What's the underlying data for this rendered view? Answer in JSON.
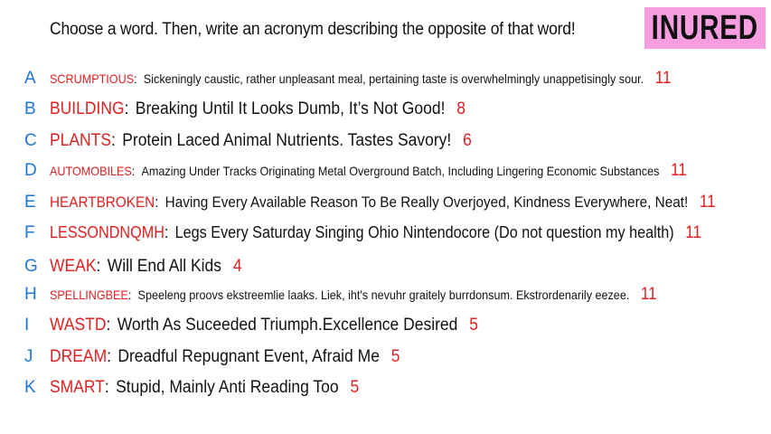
{
  "prompt": "Choose a word. Then, write an acronym describing the opposite of that word!",
  "logo": "INURED",
  "rows": [
    {
      "letter": "A",
      "word": "SCRUMPTIOUS",
      "definition": "Sickeningly caustic, rather  unpleasant  meal, pertaining  taste is overwhelmingly unappetisingly sour.",
      "score": "11"
    },
    {
      "letter": "B",
      "word": "BUILDING",
      "definition": "Breaking Until It Looks Dumb, It’s Not Good!",
      "score": "8"
    },
    {
      "letter": "C",
      "word": "PLANTS",
      "definition": "Protein Laced Animal Nutrients. Tastes Savory!",
      "score": "6"
    },
    {
      "letter": "D",
      "word": "AUTOMOBILES",
      "definition": "Amazing Under Tracks Originating Metal Overground Batch, Including Lingering Economic Substances",
      "score": "11"
    },
    {
      "letter": "E",
      "word": "HEARTBROKEN",
      "definition": "Having Every Available Reason To Be Really Overjoyed, Kindness Everywhere, Neat!",
      "score": "11"
    },
    {
      "letter": "F",
      "word": "LESSONDNQMH",
      "definition": "Legs Every Saturday Singing Ohio Nintendocore (Do not question my health)",
      "score": "11"
    },
    {
      "letter": "G",
      "word": "WEAK",
      "definition": "Will End All Kids",
      "score": "4"
    },
    {
      "letter": "H",
      "word": "SPELLINGBEE",
      "definition": "Speeleng proovs ekstreemlie laaks. Liek, iht's nevuhr graitely burrdonsum. Ekstrordenarily eezee.",
      "score": "11"
    },
    {
      "letter": "I",
      "word": "WASTD",
      "definition": "Worth As Suceeded Triumph.Excellence Desired",
      "score": "5"
    },
    {
      "letter": "J",
      "word": "DREAM",
      "definition": "Dreadful Repugnant Event, Afraid Me",
      "score": "5"
    },
    {
      "letter": "K",
      "word": "SMART",
      "definition": "Stupid, Mainly Anti Reading Too",
      "score": "5"
    }
  ]
}
